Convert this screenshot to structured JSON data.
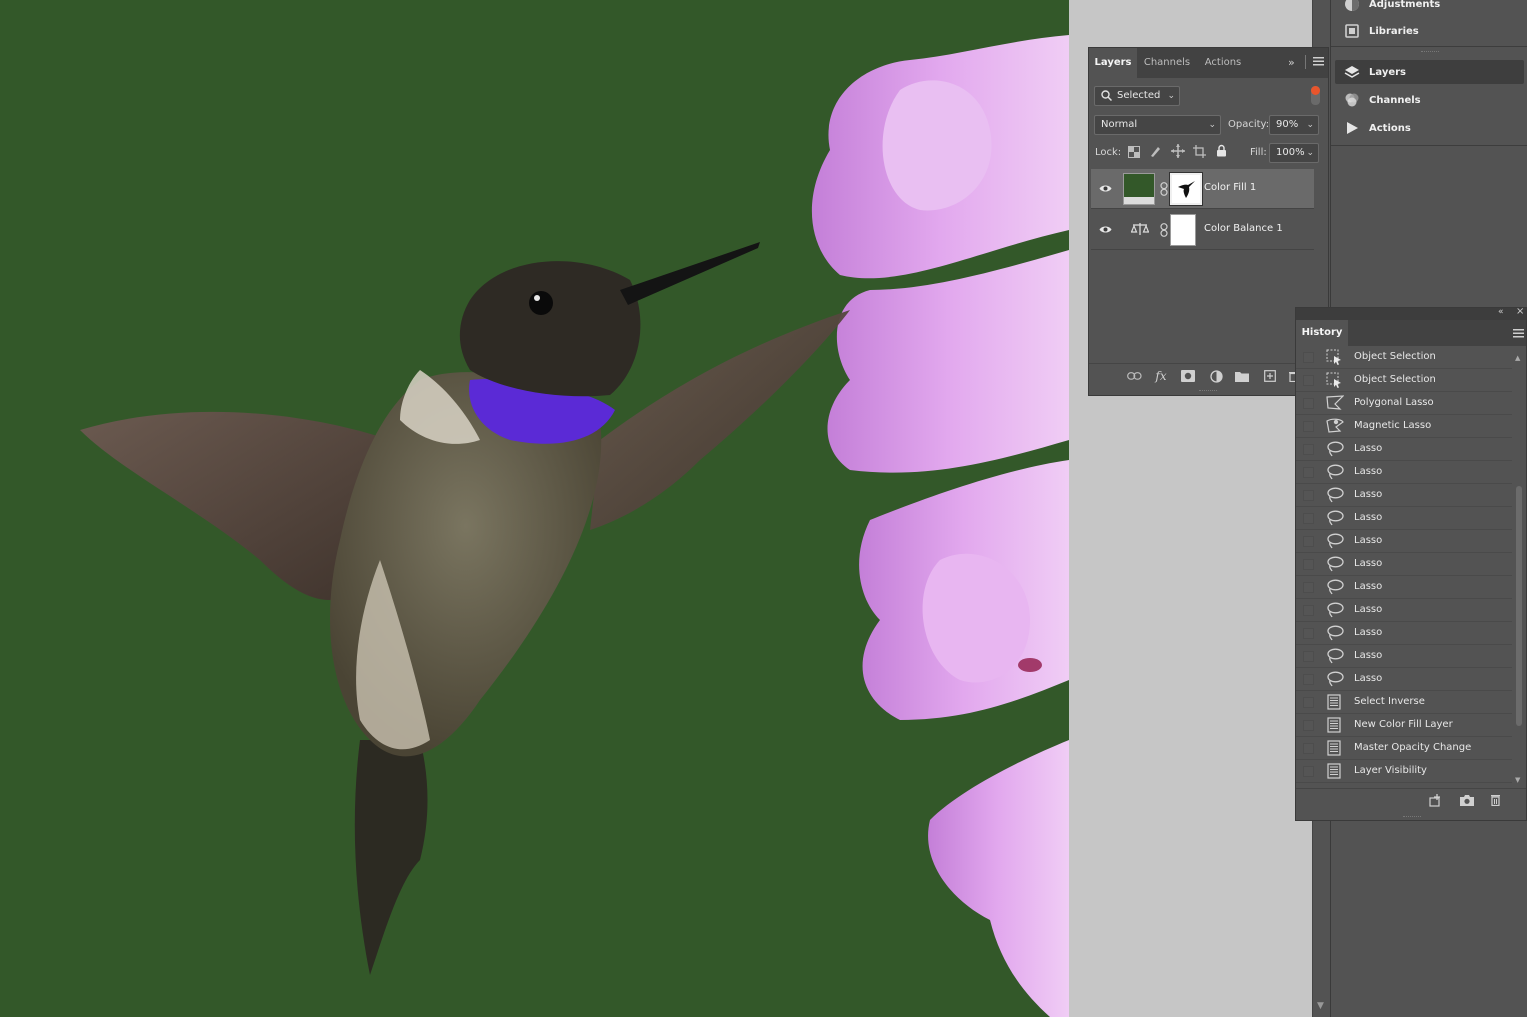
{
  "dock": {
    "items": [
      {
        "label": "Adjustments",
        "icon": "adjustments-icon",
        "active": false
      },
      {
        "label": "Libraries",
        "icon": "libraries-icon",
        "active": false
      },
      {
        "label": "Layers",
        "icon": "layers-icon",
        "active": true
      },
      {
        "label": "Channels",
        "icon": "channels-icon",
        "active": false
      },
      {
        "label": "Actions",
        "icon": "actions-icon",
        "active": false
      }
    ]
  },
  "layers_panel": {
    "tabs": [
      "Layers",
      "Channels",
      "Actions"
    ],
    "filter_value": "Selected",
    "blend_mode": "Normal",
    "opacity_label": "Opacity:",
    "opacity_value": "90%",
    "lock_label": "Lock:",
    "fill_label": "Fill:",
    "fill_value": "100%",
    "layers": [
      {
        "name": "Color Fill 1",
        "selected": true,
        "visible": true
      },
      {
        "name": "Color Balance 1",
        "selected": false,
        "visible": true
      }
    ]
  },
  "history_panel": {
    "title": "History",
    "items": [
      {
        "label": "Object Selection",
        "icon": "object-selection-icon"
      },
      {
        "label": "Object Selection",
        "icon": "object-selection-icon"
      },
      {
        "label": "Polygonal Lasso",
        "icon": "polygonal-lasso-icon"
      },
      {
        "label": "Magnetic Lasso",
        "icon": "magnetic-lasso-icon"
      },
      {
        "label": "Lasso",
        "icon": "lasso-icon"
      },
      {
        "label": "Lasso",
        "icon": "lasso-icon"
      },
      {
        "label": "Lasso",
        "icon": "lasso-icon"
      },
      {
        "label": "Lasso",
        "icon": "lasso-icon"
      },
      {
        "label": "Lasso",
        "icon": "lasso-icon"
      },
      {
        "label": "Lasso",
        "icon": "lasso-icon"
      },
      {
        "label": "Lasso",
        "icon": "lasso-icon"
      },
      {
        "label": "Lasso",
        "icon": "lasso-icon"
      },
      {
        "label": "Lasso",
        "icon": "lasso-icon"
      },
      {
        "label": "Lasso",
        "icon": "lasso-icon"
      },
      {
        "label": "Lasso",
        "icon": "lasso-icon"
      },
      {
        "label": "Select Inverse",
        "icon": "document-icon"
      },
      {
        "label": "New Color Fill Layer",
        "icon": "document-icon"
      },
      {
        "label": "Master Opacity Change",
        "icon": "document-icon"
      },
      {
        "label": "Layer Visibility",
        "icon": "document-icon"
      }
    ]
  },
  "colors": {
    "canvas_fill": "#335829",
    "pasteboard": "#c6c6c6",
    "panel_bg": "#535353",
    "flower": "#d38fe0",
    "throat": "#5b2ad6"
  }
}
